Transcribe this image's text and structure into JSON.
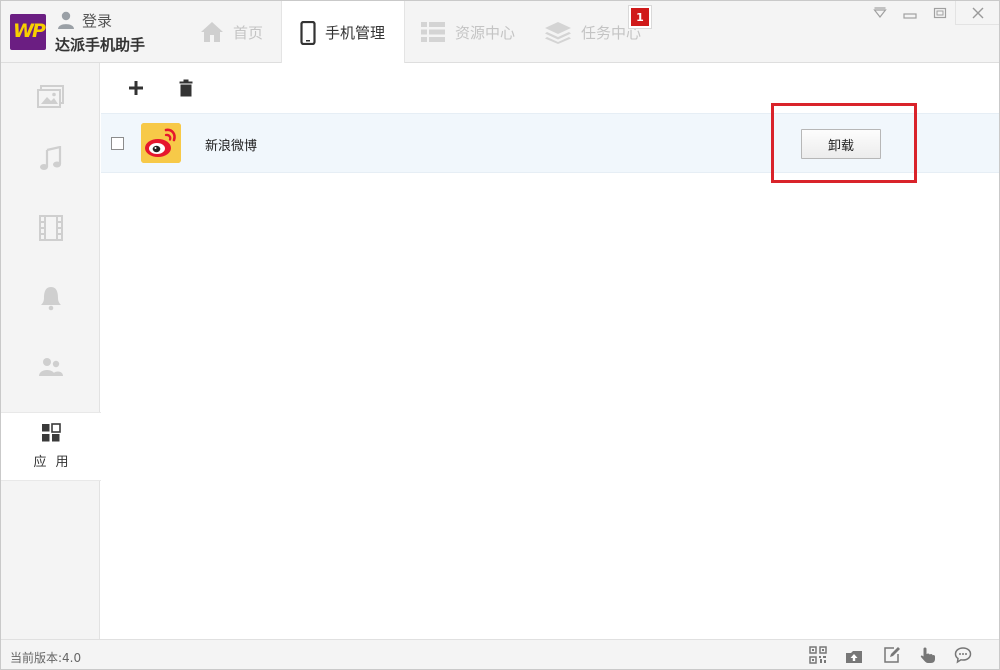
{
  "header": {
    "login_label": "登录",
    "app_name": "达派手机助手",
    "logo_text": "WP",
    "tabs": [
      {
        "label": "首页",
        "icon": "home-icon",
        "active": false
      },
      {
        "label": "手机管理",
        "icon": "phone-icon",
        "active": true
      },
      {
        "label": "资源中心",
        "icon": "list-icon",
        "active": false
      },
      {
        "label": "任务中心",
        "icon": "layers-icon",
        "active": false
      }
    ],
    "task_badge": "1"
  },
  "sidebar": {
    "items": [
      {
        "icon": "photo-icon",
        "label": ""
      },
      {
        "icon": "music-icon",
        "label": ""
      },
      {
        "icon": "film-icon",
        "label": ""
      },
      {
        "icon": "bell-icon",
        "label": ""
      },
      {
        "icon": "contacts-icon",
        "label": ""
      },
      {
        "icon": "apps-grid-icon",
        "label": "应用",
        "active": true
      }
    ]
  },
  "toolbar": {
    "icons": [
      "plus-icon",
      "trash-icon"
    ]
  },
  "app_list": [
    {
      "name": "新浪微博",
      "action_label": "卸载",
      "checked": false,
      "icon": "weibo-icon"
    }
  ],
  "status": {
    "version": "当前版本:4.0",
    "icons": [
      "qr-code-icon",
      "upload-icon",
      "edit-icon",
      "hand-pointer-icon",
      "chat-icon"
    ]
  },
  "colors": {
    "accent": "#6b1e82",
    "logo_text": "#f7d000",
    "badge": "#d01a1a",
    "highlight": "#d9232a",
    "row_bg": "#f1f7fc"
  }
}
